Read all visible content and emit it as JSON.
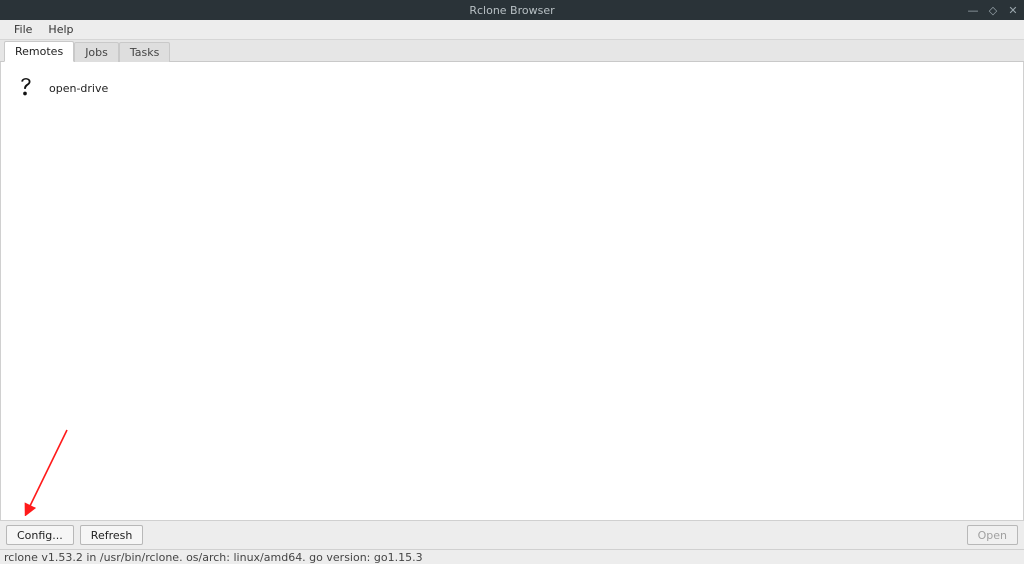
{
  "window": {
    "title": "Rclone Browser",
    "controls": {
      "minimize": "—",
      "maximize": "◇",
      "close": "✕"
    }
  },
  "menubar": {
    "file": "File",
    "help": "Help"
  },
  "tabs": {
    "remotes": "Remotes",
    "jobs": "Jobs",
    "tasks": "Tasks"
  },
  "remotes": {
    "items": [
      {
        "label": "open-drive"
      }
    ]
  },
  "buttons": {
    "config": "Config...",
    "refresh": "Refresh",
    "open": "Open"
  },
  "statusbar": {
    "text": "rclone v1.53.2 in /usr/bin/rclone. os/arch: linux/amd64. go version: go1.15.3"
  },
  "annotation": {
    "arrow_color": "#ff1a1a"
  }
}
